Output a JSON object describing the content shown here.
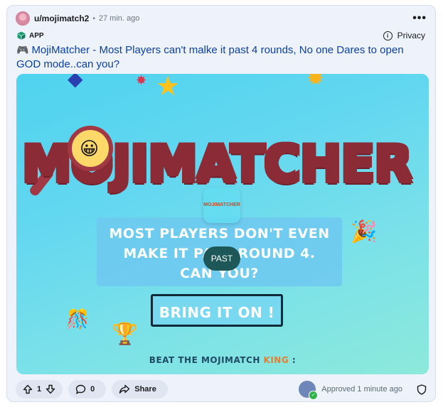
{
  "post": {
    "author": "u/mojimatch2",
    "separator": "•",
    "time": "27 min. ago",
    "more_label": "•••",
    "app_tag": "APP",
    "privacy_label": "Privacy",
    "title_icon": "🎮",
    "title": "MojiMatcher - Most Players can't malke it past 4 rounds, No one Dares to open GOD mode..can you?"
  },
  "preview": {
    "logo_text": "MOJIMATCHER",
    "logo_face": "😀",
    "app_badge": "MOJIMATCHER",
    "panel_lines": [
      "MOST PLAYERS DON'T EVEN",
      "MAKE IT PAST ROUND 4.",
      "CAN YOU?"
    ],
    "overlay_button": "PAST",
    "cta": "BRING IT ON !",
    "beat_prefix": "BEAT THE MOJIMATCH ",
    "beat_king": "KING",
    "beat_suffix": " :",
    "deco_icons": [
      "star-icon",
      "star-icon",
      "party-popper-icon",
      "trophy-icon",
      "party-popper-icon"
    ]
  },
  "footer": {
    "vote_count": "1",
    "comment_count": "0",
    "share_label": "Share",
    "approved_text": "Approved 1 minute ago"
  },
  "colors": {
    "title": "#0b3fa5",
    "card_bg": "#eef3fb",
    "preview_bg": "#4fd3ef",
    "past_button": "#1e5757",
    "cta_border": "#0f2b3a"
  }
}
